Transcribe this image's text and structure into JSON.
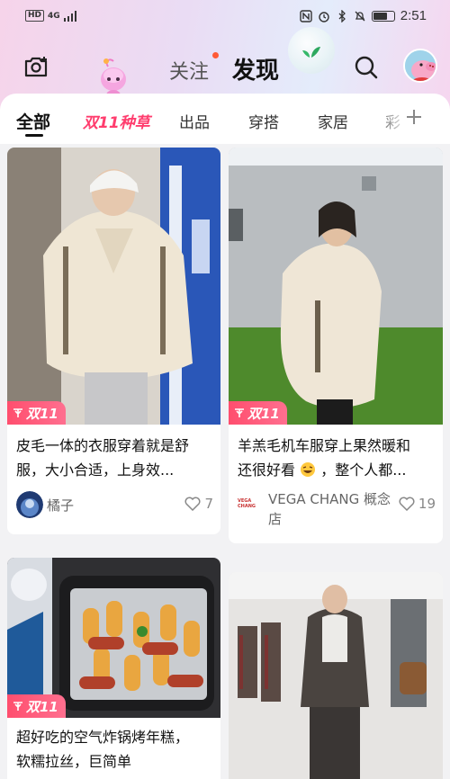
{
  "status_bar": {
    "hd": "HD",
    "signal": "4G",
    "time": "2:51"
  },
  "header": {
    "follow_label": "关注",
    "discover_label": "发现"
  },
  "category_tabs": [
    {
      "label": "全部"
    },
    {
      "label": "双11种草"
    },
    {
      "label": "出品"
    },
    {
      "label": "穿搭"
    },
    {
      "label": "家居"
    },
    {
      "label": "彩"
    }
  ],
  "badge_label": "双11",
  "cards": [
    {
      "title_line1": "皮毛一体的衣服穿着就是舒",
      "title_line2": "服，大小合适，上身效...",
      "author": "橘子",
      "likes": "7"
    },
    {
      "title_line1": "羊羔毛机车服穿上果然暖和",
      "title_line2": "还很好看",
      "title_line2_tail": "，整个人都...",
      "author_logo": "VEGA CHANG",
      "author": "VEGA CHANG 概念",
      "author_line2": "店",
      "likes": "19"
    },
    {
      "title_line1": "超好吃的空气炸锅烤年糕，",
      "title_line2": "软糯拉丝，巨简单"
    },
    {}
  ],
  "colors": {
    "accent": "#ff3d6e",
    "badge": "#ff4e6e"
  }
}
